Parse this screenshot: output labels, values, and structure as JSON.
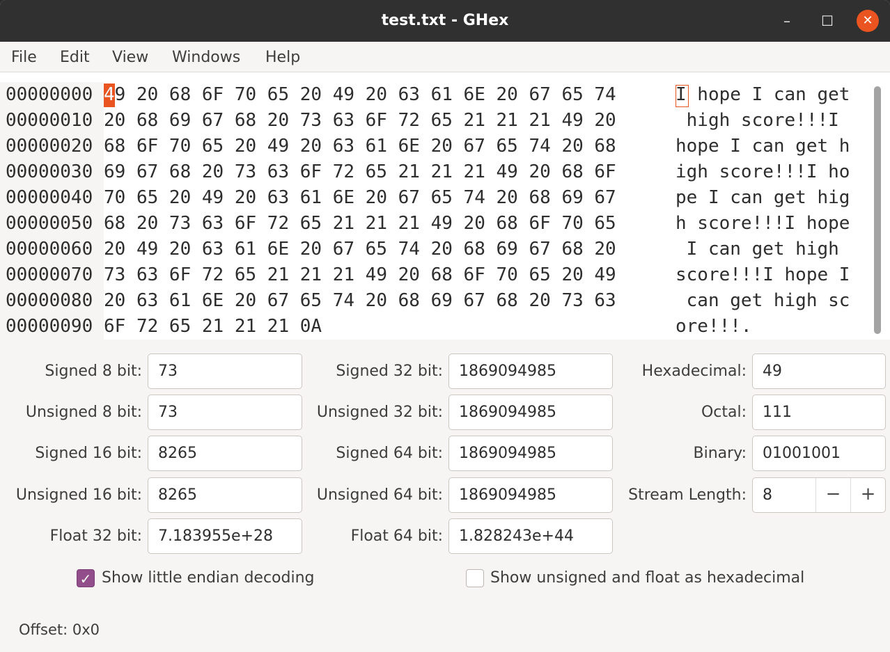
{
  "window": {
    "title": "test.txt - GHex",
    "minimize_glyph": "–",
    "maximize_glyph": "☐",
    "close_glyph": "✕"
  },
  "menu": [
    "File",
    "Edit",
    "View",
    "Windows",
    "Help"
  ],
  "hex_view": {
    "offsets": [
      "00000000",
      "00000010",
      "00000020",
      "00000030",
      "00000040",
      "00000050",
      "00000060",
      "00000070",
      "00000080",
      "00000090"
    ],
    "hex_rows": [
      "49 20 68 6F 70 65 20 49 20 63 61 6E 20 67 65 74",
      "20 68 69 67 68 20 73 63 6F 72 65 21 21 21 49 20",
      "68 6F 70 65 20 49 20 63 61 6E 20 67 65 74 20 68",
      "69 67 68 20 73 63 6F 72 65 21 21 21 49 20 68 6F",
      "70 65 20 49 20 63 61 6E 20 67 65 74 20 68 69 67",
      "68 20 73 63 6F 72 65 21 21 21 49 20 68 6F 70 65",
      "20 49 20 63 61 6E 20 67 65 74 20 68 69 67 68 20",
      "73 63 6F 72 65 21 21 21 49 20 68 6F 70 65 20 49",
      "20 63 61 6E 20 67 65 74 20 68 69 67 68 20 73 63",
      "6F 72 65 21 21 21 0A"
    ],
    "ascii_rows": [
      "I hope I can get",
      " high score!!!I ",
      "hope I can get h",
      "igh score!!!I ho",
      "pe I can get hig",
      "h score!!!I hope",
      " I can get high ",
      "score!!!I hope I",
      " can get high sc",
      "ore!!!."
    ],
    "cursor_nibble": "4"
  },
  "converter": {
    "signed_8_label": "Signed 8 bit:",
    "signed_8_value": "73",
    "unsigned_8_label": "Unsigned 8 bit:",
    "unsigned_8_value": "73",
    "signed_16_label": "Signed 16 bit:",
    "signed_16_value": "8265",
    "unsigned_16_label": "Unsigned 16 bit:",
    "unsigned_16_value": "8265",
    "float_32_label": "Float 32 bit:",
    "float_32_value": "7.183955e+28",
    "signed_32_label": "Signed 32 bit:",
    "signed_32_value": "1869094985",
    "unsigned_32_label": "Unsigned 32 bit:",
    "unsigned_32_value": "1869094985",
    "signed_64_label": "Signed 64 bit:",
    "signed_64_value": "1869094985",
    "unsigned_64_label": "Unsigned 64 bit:",
    "unsigned_64_value": "1869094985",
    "float_64_label": "Float 64 bit:",
    "float_64_value": "1.828243e+44",
    "hex_label": "Hexadecimal:",
    "hex_value": "49",
    "octal_label": "Octal:",
    "octal_value": "111",
    "binary_label": "Binary:",
    "binary_value": "01001001",
    "stream_label": "Stream Length:",
    "stream_value": "8",
    "minus_glyph": "−",
    "plus_glyph": "+"
  },
  "options": {
    "little_endian_label": "Show little endian decoding",
    "little_endian_checked": true,
    "unsigned_hex_label": "Show unsigned and float as hexadecimal",
    "unsigned_hex_checked": false,
    "check_glyph": "✓"
  },
  "status": {
    "offset_text": "Offset: 0x0"
  },
  "colors": {
    "accent": "#e95420",
    "checkbox": "#924d8b",
    "titlebar": "#303030"
  }
}
